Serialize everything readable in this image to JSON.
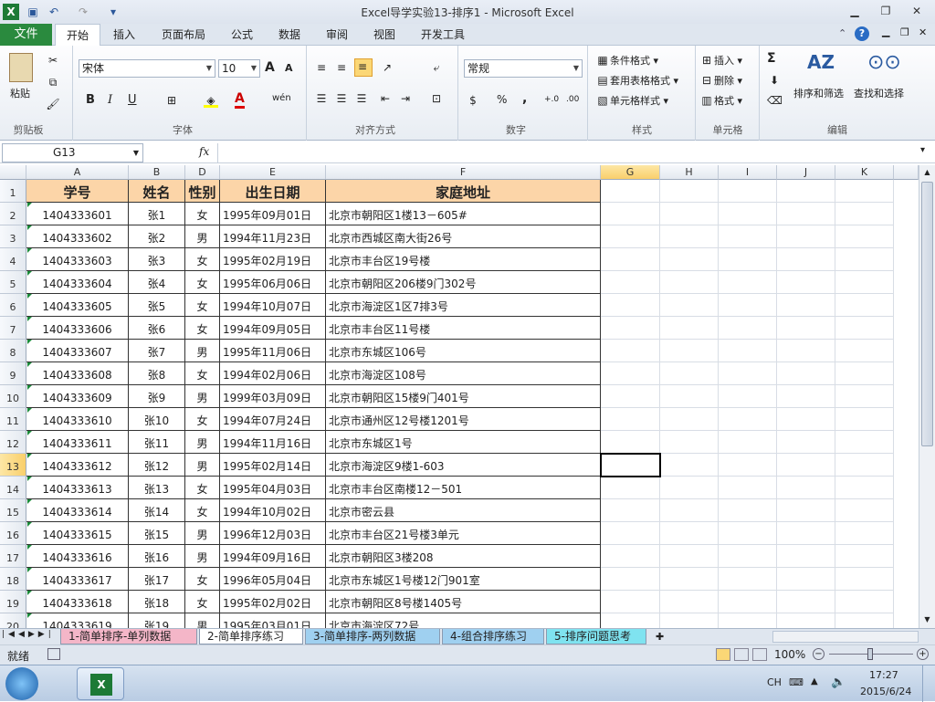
{
  "window": {
    "title": "Excel导学实验13-排序1  -  Microsoft Excel"
  },
  "tabs": [
    "开始",
    "插入",
    "页面布局",
    "公式",
    "数据",
    "审阅",
    "视图",
    "开发工具"
  ],
  "file_tab": "文件",
  "ribbon": {
    "clipboard": {
      "paste": "粘贴",
      "label": "剪贴板"
    },
    "font": {
      "name": "宋体",
      "size": "10",
      "bold": "B",
      "italic": "I",
      "underline": "U",
      "label": "字体",
      "grow": "A",
      "shrink": "A",
      "phonetic": "wén"
    },
    "alignment": {
      "label": "对齐方式"
    },
    "number": {
      "format": "常规",
      "label": "数字",
      "percent": "%",
      "comma": ",",
      "inc": "+.0",
      "dec": ".00"
    },
    "styles": {
      "conditional": "条件格式",
      "table": "套用表格格式",
      "cell": "单元格样式",
      "label": "样式"
    },
    "cells": {
      "insert": "插入",
      "delete": "删除",
      "format": "格式",
      "label": "单元格"
    },
    "editing": {
      "sort": "排序和筛选",
      "find": "查找和选择",
      "label": "编辑",
      "sum": "Σ"
    }
  },
  "formula_bar": {
    "name_box": "G13",
    "fx": "fx",
    "value": ""
  },
  "columns": [
    "A",
    "B",
    "D",
    "E",
    "F",
    "G",
    "H",
    "I",
    "J",
    "K"
  ],
  "headers": [
    "学号",
    "姓名",
    "性别",
    "出生日期",
    "家庭地址"
  ],
  "rows": [
    [
      "1404333601",
      "张1",
      "女",
      "1995年09月01日",
      "北京市朝阳区1楼13－605#"
    ],
    [
      "1404333602",
      "张2",
      "男",
      "1994年11月23日",
      "北京市西城区南大街26号"
    ],
    [
      "1404333603",
      "张3",
      "女",
      "1995年02月19日",
      "北京市丰台区19号楼"
    ],
    [
      "1404333604",
      "张4",
      "女",
      "1995年06月06日",
      "北京市朝阳区206楼9门302号"
    ],
    [
      "1404333605",
      "张5",
      "女",
      "1994年10月07日",
      "北京市海淀区1区7排3号"
    ],
    [
      "1404333606",
      "张6",
      "女",
      "1994年09月05日",
      "北京市丰台区11号楼"
    ],
    [
      "1404333607",
      "张7",
      "男",
      "1995年11月06日",
      "北京市东城区106号"
    ],
    [
      "1404333608",
      "张8",
      "女",
      "1994年02月06日",
      "北京市海淀区108号"
    ],
    [
      "1404333609",
      "张9",
      "男",
      "1999年03月09日",
      "北京市朝阳区15楼9门401号"
    ],
    [
      "1404333610",
      "张10",
      "女",
      "1994年07月24日",
      "北京市通州区12号楼1201号"
    ],
    [
      "1404333611",
      "张11",
      "男",
      "1994年11月16日",
      "北京市东城区1号"
    ],
    [
      "1404333612",
      "张12",
      "男",
      "1995年02月14日",
      "北京市海淀区9楼1-603"
    ],
    [
      "1404333613",
      "张13",
      "女",
      "1995年04月03日",
      "北京市丰台区南楼12－501"
    ],
    [
      "1404333614",
      "张14",
      "女",
      "1994年10月02日",
      "北京市密云县"
    ],
    [
      "1404333615",
      "张15",
      "男",
      "1996年12月03日",
      "北京市丰台区21号楼3单元"
    ],
    [
      "1404333616",
      "张16",
      "男",
      "1994年09月16日",
      "北京市朝阳区3楼208"
    ],
    [
      "1404333617",
      "张17",
      "女",
      "1996年05月04日",
      "北京市东城区1号楼12门901室"
    ],
    [
      "1404333618",
      "张18",
      "女",
      "1995年02月02日",
      "北京市朝阳区8号楼1405号"
    ],
    [
      "1404333619",
      "张19",
      "男",
      "1995年03月01日",
      "北京市海淀区72号"
    ]
  ],
  "row_numbers": [
    "1",
    "2",
    "3",
    "4",
    "5",
    "6",
    "7",
    "8",
    "9",
    "10",
    "11",
    "12",
    "13",
    "14",
    "15",
    "16",
    "17",
    "18",
    "19",
    "20"
  ],
  "sheets": [
    "1-简单排序-单列数据",
    "2-简单排序练习",
    "3-简单排序-两列数据",
    "4-组合排序练习",
    "5-排序问题思考"
  ],
  "sheet_colors": [
    "#f4b6c8",
    "#ffffff",
    "#9fd0f0",
    "#9fd0f0",
    "#7fe3f0"
  ],
  "status": {
    "ready": "就绪",
    "zoom": "100%"
  },
  "taskbar": {
    "lang": "CH",
    "time": "17:27",
    "date": "2015/6/24"
  }
}
